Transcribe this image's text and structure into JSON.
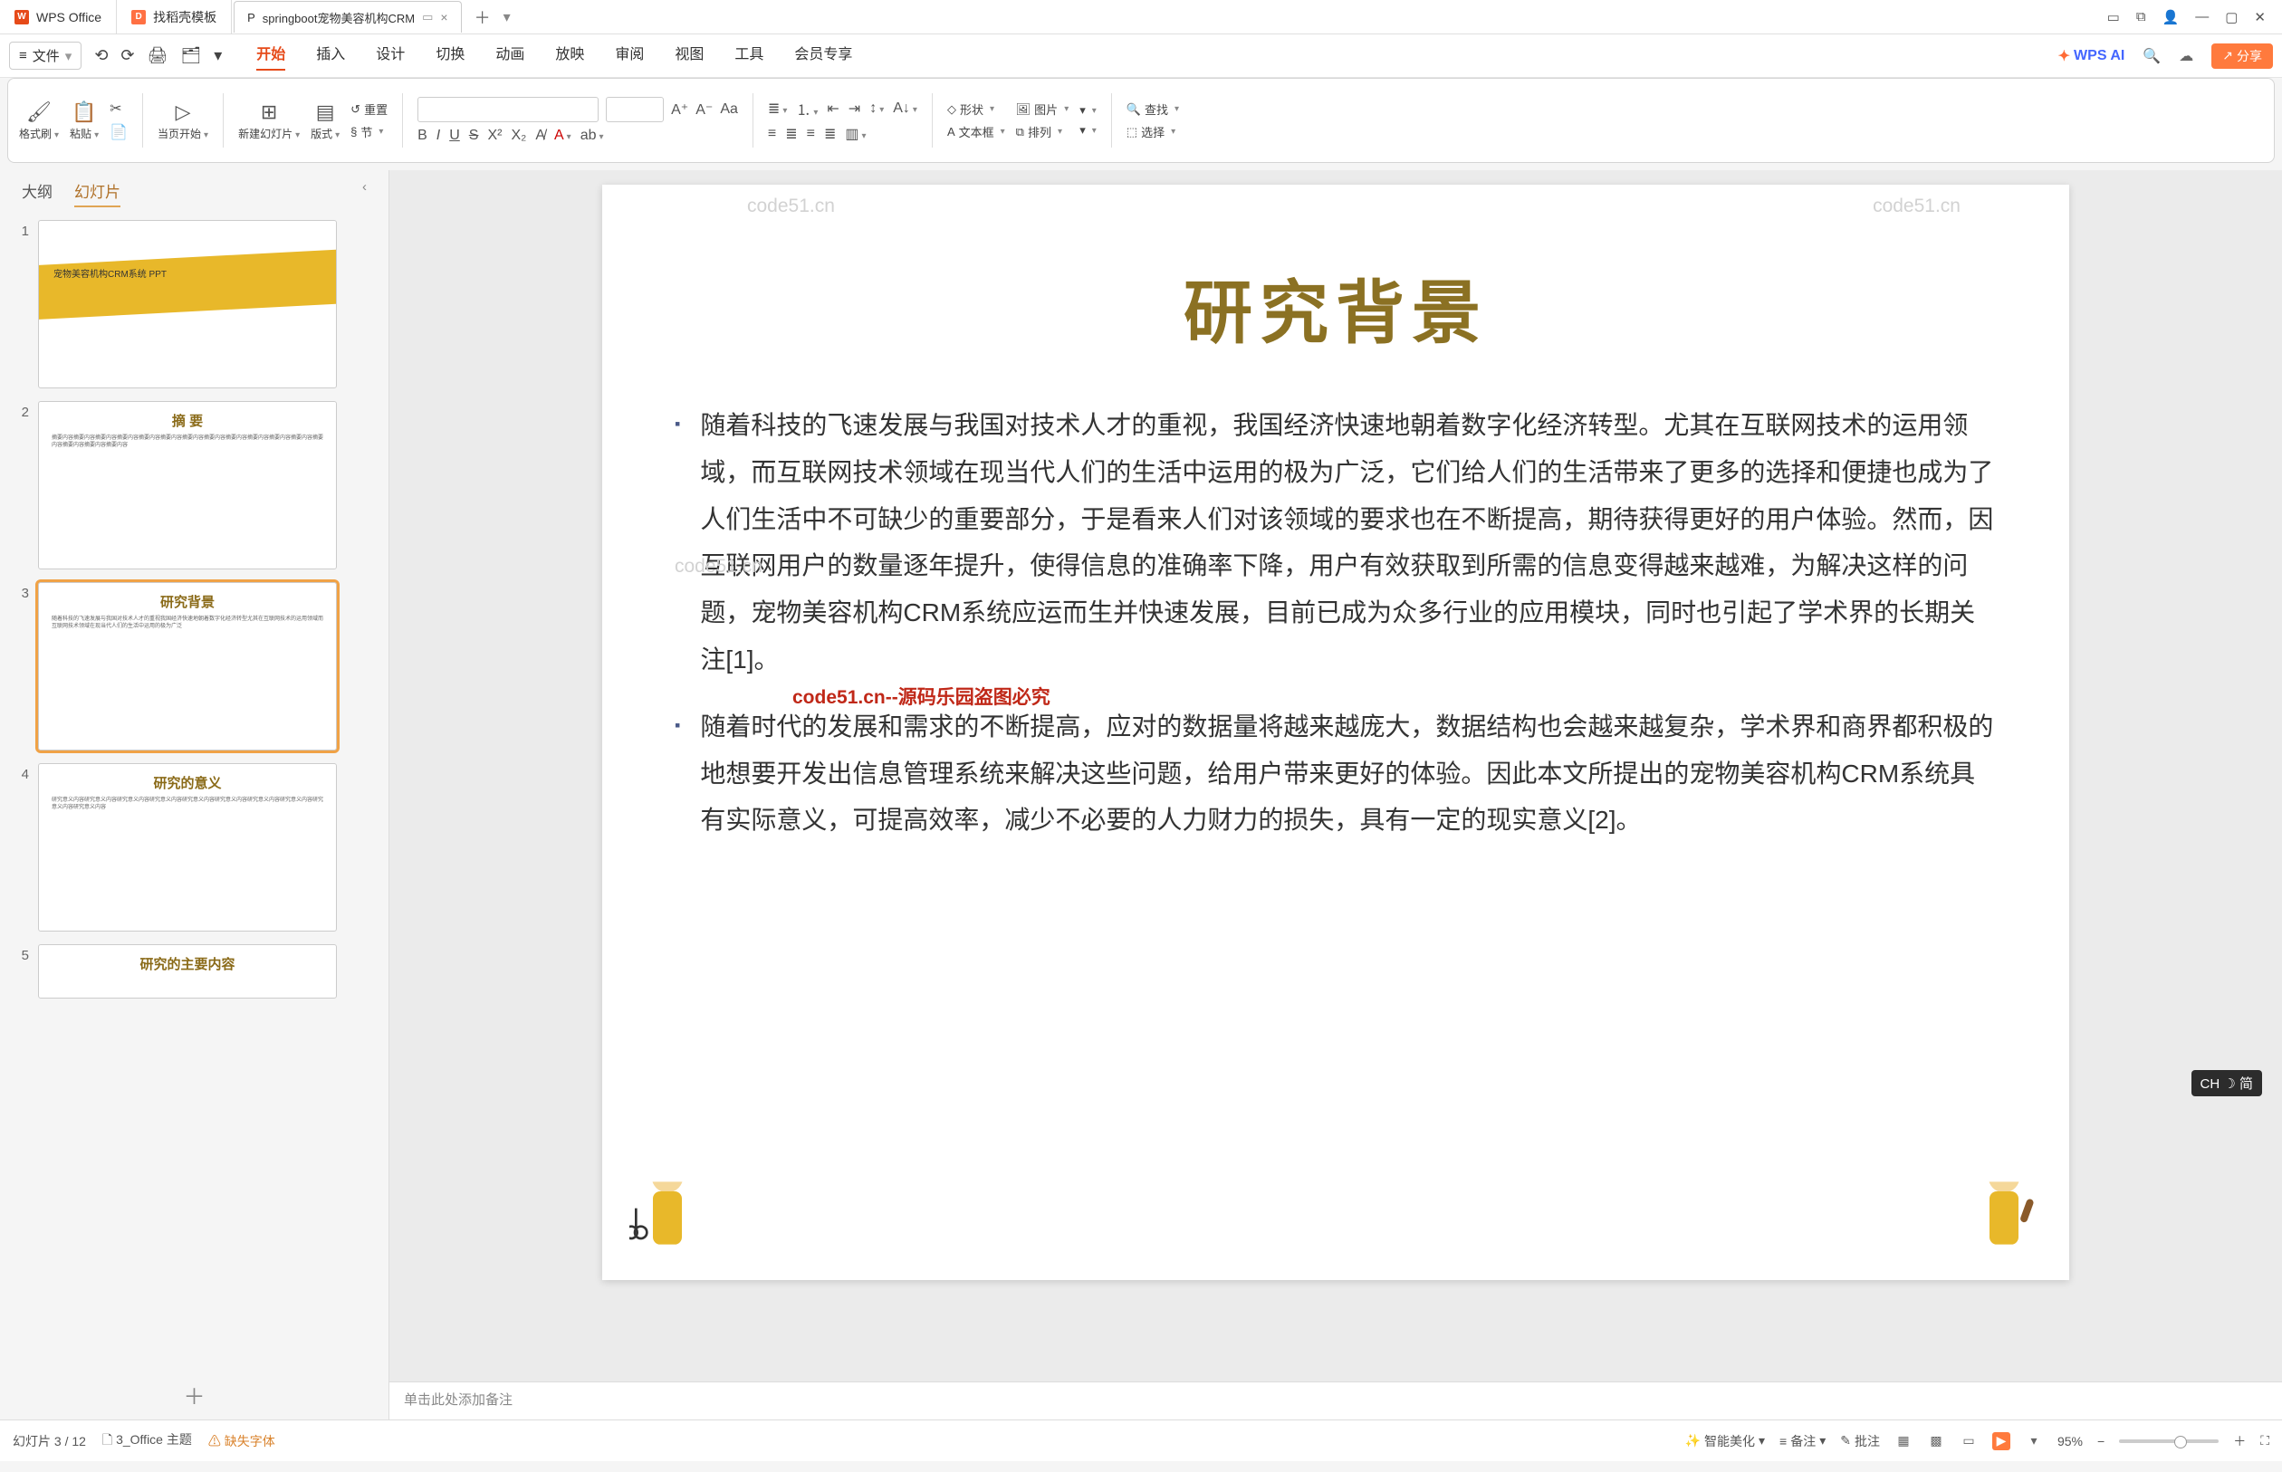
{
  "titlebar": {
    "apps": [
      {
        "label": "WPS Office",
        "icon": "W"
      },
      {
        "label": "找稻壳模板",
        "icon": "D"
      }
    ],
    "doc_tab": {
      "icon": "P",
      "label": "springboot宠物美容机构CRM",
      "close": "×"
    },
    "plus": "＋",
    "dd": "▾",
    "win": {
      "panel": "▭",
      "cube": "⧉",
      "avatar": "👤",
      "min": "—",
      "max": "▢",
      "close": "✕"
    }
  },
  "menubar": {
    "file": "文件",
    "hamburger": "≡",
    "quick": [
      "⟲",
      "⟳",
      "🖨",
      "🗂",
      "▾"
    ],
    "tabs": [
      "开始",
      "插入",
      "设计",
      "切换",
      "动画",
      "放映",
      "审阅",
      "视图",
      "工具",
      "会员专享"
    ],
    "wpsai": "WPS AI",
    "search": "🔍",
    "cloud": "☁",
    "share_icon": "↗",
    "share": "分享"
  },
  "ribbon": {
    "format_painter": {
      "icon": "🖌",
      "label": "格式刷"
    },
    "paste": {
      "icon": "📋",
      "label": "粘贴"
    },
    "cut": "✂",
    "copy": "📄",
    "play": {
      "icon": "▷",
      "label": "当页开始"
    },
    "new_slide": {
      "icon": "⊞",
      "label": "新建幻灯片"
    },
    "layout": {
      "icon": "▤",
      "label": "版式"
    },
    "reset": {
      "icon": "↺",
      "label": "重置"
    },
    "section": {
      "icon": "§",
      "label": "节"
    },
    "bold": "B",
    "italic": "I",
    "underline": "U",
    "strike": "S",
    "sup": "X²",
    "sub": "X₂",
    "clear": "A̸",
    "font_color": "A",
    "highlight": "ab",
    "bullet": "≣",
    "number": "⒈",
    "indent_l": "⇤",
    "indent_r": "⇥",
    "align_l": "≡",
    "align_c": "≣",
    "align_r": "≡",
    "align_j": "≣",
    "line_space": "↕",
    "text_dir": "A↓",
    "columns": "▥",
    "shape": {
      "icon": "◇",
      "label": "形状"
    },
    "image": {
      "icon": "🖼",
      "label": "图片"
    },
    "textbox": {
      "icon": "A",
      "label": "文本框"
    },
    "arrange": {
      "icon": "⧉",
      "label": "排列"
    },
    "find": {
      "icon": "🔍",
      "label": "查找"
    },
    "select": {
      "icon": "⬚",
      "label": "选择"
    }
  },
  "sidepanel": {
    "tab_outline": "大纲",
    "tab_slides": "幻灯片",
    "collapse": "‹",
    "thumbs": [
      {
        "n": "1",
        "title": "宠物美容机构CRM系统 PPT"
      },
      {
        "n": "2",
        "title": "摘 要"
      },
      {
        "n": "3",
        "title": "研究背景"
      },
      {
        "n": "4",
        "title": "研究的意义"
      },
      {
        "n": "5",
        "title": "研究的主要内容"
      }
    ],
    "add": "＋"
  },
  "slide": {
    "title": "研究背景",
    "para1": "随着科技的飞速发展与我国对技术人才的重视，我国经济快速地朝着数字化经济转型。尤其在互联网技术的运用领域，而互联网技术领域在现当代人们的生活中运用的极为广泛，它们给人们的生活带来了更多的选择和便捷也成为了人们生活中不可缺少的重要部分，于是看来人们对该领域的要求也在不断提高，期待获得更好的用户体验。然而，因互联网用户的数量逐年提升，使得信息的准确率下降，用户有效获取到所需的信息变得越来越难，为解决这样的问题，宠物美容机构CRM系统应运而生并快速发展，目前已成为众多行业的应用模块，同时也引起了学术界的长期关注[1]。",
    "para2": "随着时代的发展和需求的不断提高，应对的数据量将越来越庞大，数据结构也会越来越复杂，学术界和商界都积极的地想要开发出信息管理系统来解决这些问题，给用户带来更好的体验。因此本文所提出的宠物美容机构CRM系统具有实际意义，可提高效率，减少不必要的人力财力的损失，具有一定的现实意义[2]。"
  },
  "notes": {
    "placeholder": "单击此处添加备注"
  },
  "status": {
    "slide_count": "幻灯片 3 / 12",
    "theme": "3_Office 主题",
    "missing_font": "缺失字体",
    "smart": "智能美化",
    "remark": "备注",
    "approve": "批注",
    "zoom": "95%",
    "zoom_minus": "−",
    "zoom_plus": "＋",
    "fit": "⛶"
  },
  "ime": "CH ☽ 简",
  "watermark": "code51.cn",
  "watermark_red": "code51.cn--源码乐园盗图必究"
}
